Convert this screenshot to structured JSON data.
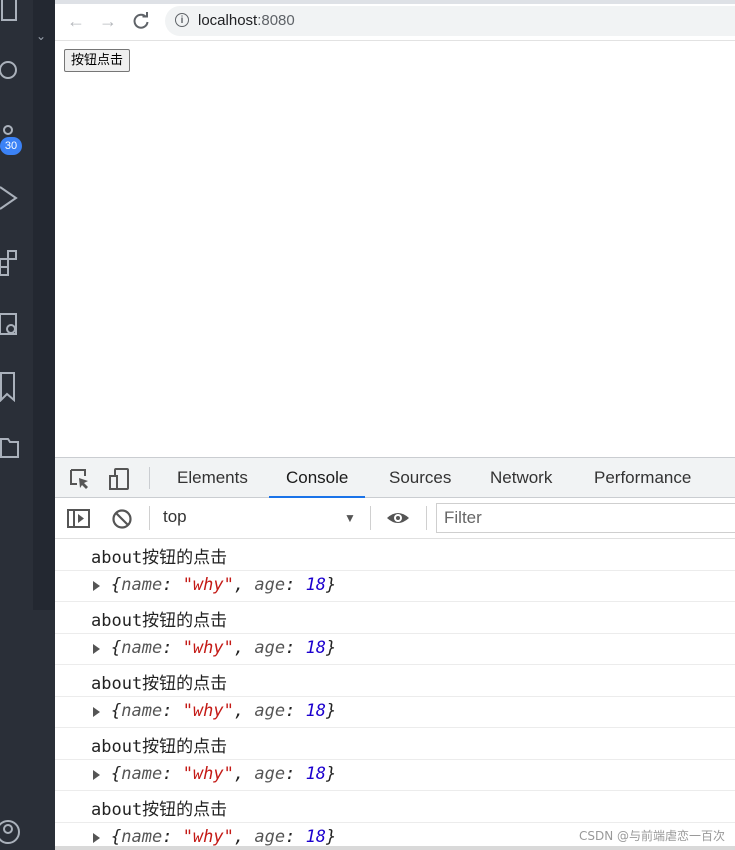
{
  "editor": {
    "badge_count": "30"
  },
  "browser": {
    "url_host": "localhost",
    "url_port": ":8080"
  },
  "page": {
    "button_label": "按钮点击"
  },
  "devtools": {
    "tabs": [
      "Elements",
      "Console",
      "Sources",
      "Network",
      "Performance"
    ],
    "active_tab": "Console",
    "context": "top",
    "filter_placeholder": "Filter"
  },
  "console": {
    "messages": [
      {
        "text": "about按钮的点击"
      },
      {
        "obj": {
          "open": "{",
          "k1": "name",
          "v1": "\"why\"",
          "k2": "age",
          "v2": "18",
          "close": "}"
        }
      },
      {
        "text": "about按钮的点击"
      },
      {
        "obj": {
          "open": "{",
          "k1": "name",
          "v1": "\"why\"",
          "k2": "age",
          "v2": "18",
          "close": "}"
        }
      },
      {
        "text": "about按钮的点击"
      },
      {
        "obj": {
          "open": "{",
          "k1": "name",
          "v1": "\"why\"",
          "k2": "age",
          "v2": "18",
          "close": "}"
        }
      },
      {
        "text": "about按钮的点击"
      },
      {
        "obj": {
          "open": "{",
          "k1": "name",
          "v1": "\"why\"",
          "k2": "age",
          "v2": "18",
          "close": "}"
        }
      },
      {
        "text": "about按钮的点击"
      },
      {
        "obj": {
          "open": "{",
          "k1": "name",
          "v1": "\"why\"",
          "k2": "age",
          "v2": "18",
          "close": "}"
        }
      }
    ]
  },
  "watermark": "CSDN @与前端虐恋一百次",
  "colors": {
    "accent": "#1a73e8",
    "string": "#c41a16",
    "number": "#1c00cf",
    "badge": "#3b82f6"
  }
}
